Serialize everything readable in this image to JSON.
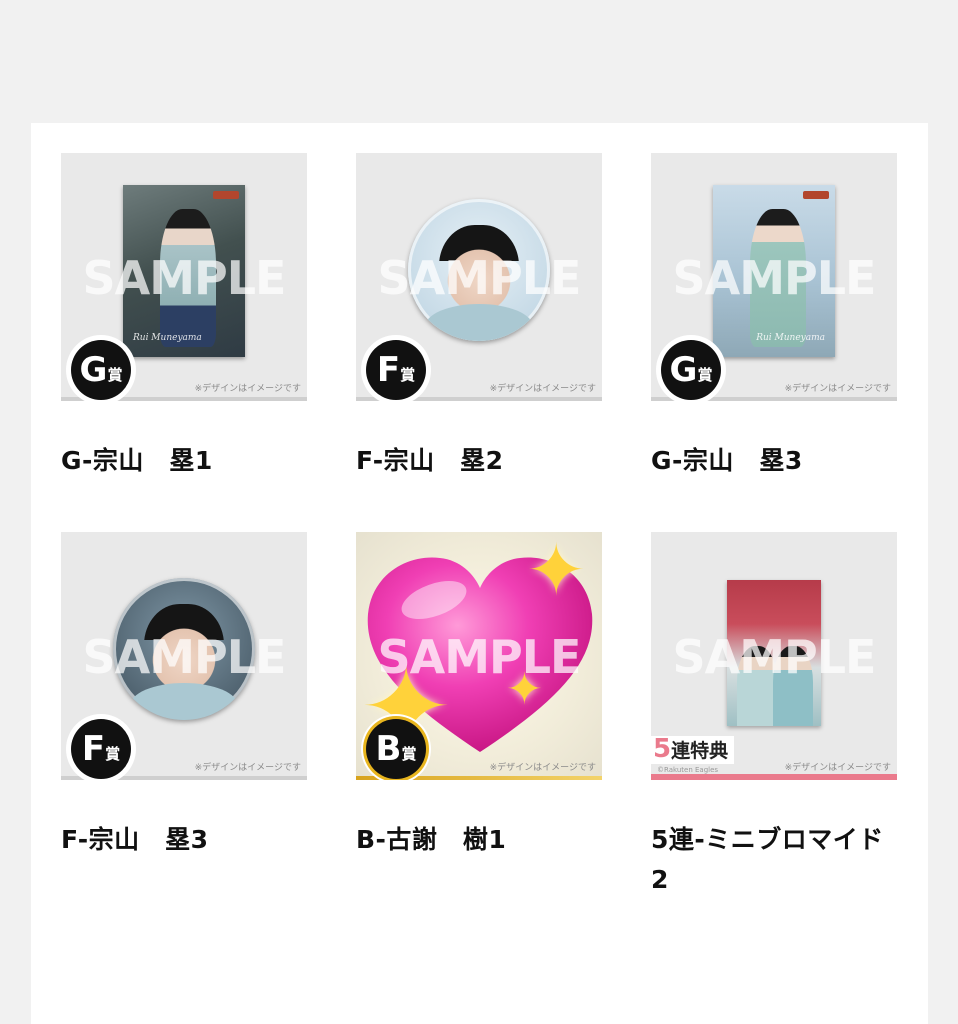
{
  "items": [
    {
      "title": "G-宗山　塁1",
      "prize_letter": "G",
      "prize_kanji": "賞",
      "sample": "SAMPLE",
      "note": "※デザインはイメージです",
      "signature": "Rui Muneyama"
    },
    {
      "title": "F-宗山　塁2",
      "prize_letter": "F",
      "prize_kanji": "賞",
      "sample": "SAMPLE",
      "note": "※デザインはイメージです"
    },
    {
      "title": "G-宗山　塁3",
      "prize_letter": "G",
      "prize_kanji": "賞",
      "sample": "SAMPLE",
      "note": "※デザインはイメージです",
      "signature": "Rui Muneyama"
    },
    {
      "title": "F-宗山　塁3",
      "prize_letter": "F",
      "prize_kanji": "賞",
      "sample": "SAMPLE",
      "note": "※デザインはイメージです"
    },
    {
      "title": "B-古謝　樹1",
      "prize_letter": "B",
      "prize_kanji": "賞",
      "sample": "SAMPLE",
      "note": "※デザインはイメージです"
    },
    {
      "title": "5連-ミニブロマイド2",
      "bonus_num": "5",
      "bonus_text": "連特典",
      "sample": "SAMPLE",
      "note": "※デザインはイメージです",
      "credit": "©Rakuten Eagles"
    }
  ],
  "colors": {
    "page_bg": "#f1f1f1",
    "panel_bg": "#ffffff",
    "badge_bg": "#111111",
    "bonus_pink": "#ea7a8c",
    "gold": "#e8b51e"
  },
  "icons": [
    "prize-badge-icon",
    "sparkle-icon",
    "heart-icon"
  ]
}
